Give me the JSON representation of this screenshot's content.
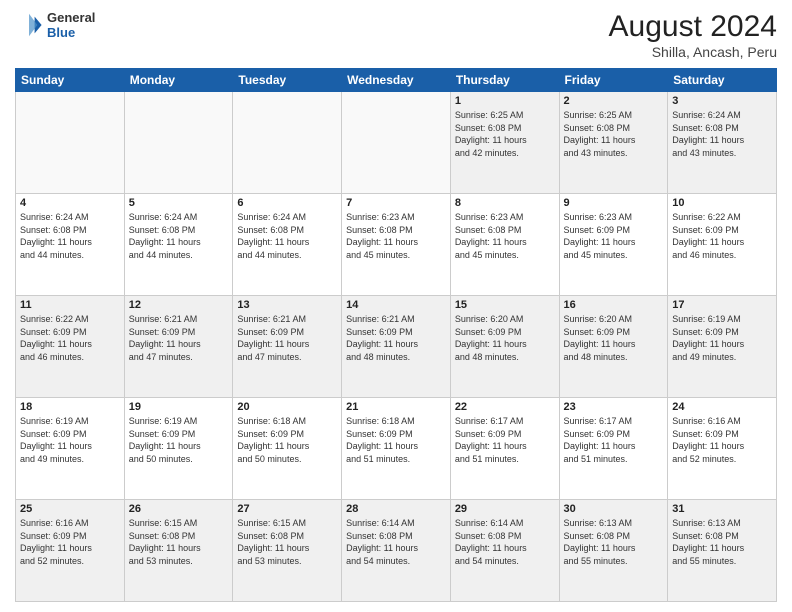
{
  "header": {
    "logo": {
      "general": "General",
      "blue": "Blue"
    },
    "title": "August 2024",
    "location": "Shilla, Ancash, Peru"
  },
  "days_of_week": [
    "Sunday",
    "Monday",
    "Tuesday",
    "Wednesday",
    "Thursday",
    "Friday",
    "Saturday"
  ],
  "weeks": [
    [
      {
        "day": "",
        "info": ""
      },
      {
        "day": "",
        "info": ""
      },
      {
        "day": "",
        "info": ""
      },
      {
        "day": "",
        "info": ""
      },
      {
        "day": "1",
        "info": "Sunrise: 6:25 AM\nSunset: 6:08 PM\nDaylight: 11 hours\nand 42 minutes."
      },
      {
        "day": "2",
        "info": "Sunrise: 6:25 AM\nSunset: 6:08 PM\nDaylight: 11 hours\nand 43 minutes."
      },
      {
        "day": "3",
        "info": "Sunrise: 6:24 AM\nSunset: 6:08 PM\nDaylight: 11 hours\nand 43 minutes."
      }
    ],
    [
      {
        "day": "4",
        "info": "Sunrise: 6:24 AM\nSunset: 6:08 PM\nDaylight: 11 hours\nand 44 minutes."
      },
      {
        "day": "5",
        "info": "Sunrise: 6:24 AM\nSunset: 6:08 PM\nDaylight: 11 hours\nand 44 minutes."
      },
      {
        "day": "6",
        "info": "Sunrise: 6:24 AM\nSunset: 6:08 PM\nDaylight: 11 hours\nand 44 minutes."
      },
      {
        "day": "7",
        "info": "Sunrise: 6:23 AM\nSunset: 6:08 PM\nDaylight: 11 hours\nand 45 minutes."
      },
      {
        "day": "8",
        "info": "Sunrise: 6:23 AM\nSunset: 6:08 PM\nDaylight: 11 hours\nand 45 minutes."
      },
      {
        "day": "9",
        "info": "Sunrise: 6:23 AM\nSunset: 6:09 PM\nDaylight: 11 hours\nand 45 minutes."
      },
      {
        "day": "10",
        "info": "Sunrise: 6:22 AM\nSunset: 6:09 PM\nDaylight: 11 hours\nand 46 minutes."
      }
    ],
    [
      {
        "day": "11",
        "info": "Sunrise: 6:22 AM\nSunset: 6:09 PM\nDaylight: 11 hours\nand 46 minutes."
      },
      {
        "day": "12",
        "info": "Sunrise: 6:21 AM\nSunset: 6:09 PM\nDaylight: 11 hours\nand 47 minutes."
      },
      {
        "day": "13",
        "info": "Sunrise: 6:21 AM\nSunset: 6:09 PM\nDaylight: 11 hours\nand 47 minutes."
      },
      {
        "day": "14",
        "info": "Sunrise: 6:21 AM\nSunset: 6:09 PM\nDaylight: 11 hours\nand 48 minutes."
      },
      {
        "day": "15",
        "info": "Sunrise: 6:20 AM\nSunset: 6:09 PM\nDaylight: 11 hours\nand 48 minutes."
      },
      {
        "day": "16",
        "info": "Sunrise: 6:20 AM\nSunset: 6:09 PM\nDaylight: 11 hours\nand 48 minutes."
      },
      {
        "day": "17",
        "info": "Sunrise: 6:19 AM\nSunset: 6:09 PM\nDaylight: 11 hours\nand 49 minutes."
      }
    ],
    [
      {
        "day": "18",
        "info": "Sunrise: 6:19 AM\nSunset: 6:09 PM\nDaylight: 11 hours\nand 49 minutes."
      },
      {
        "day": "19",
        "info": "Sunrise: 6:19 AM\nSunset: 6:09 PM\nDaylight: 11 hours\nand 50 minutes."
      },
      {
        "day": "20",
        "info": "Sunrise: 6:18 AM\nSunset: 6:09 PM\nDaylight: 11 hours\nand 50 minutes."
      },
      {
        "day": "21",
        "info": "Sunrise: 6:18 AM\nSunset: 6:09 PM\nDaylight: 11 hours\nand 51 minutes."
      },
      {
        "day": "22",
        "info": "Sunrise: 6:17 AM\nSunset: 6:09 PM\nDaylight: 11 hours\nand 51 minutes."
      },
      {
        "day": "23",
        "info": "Sunrise: 6:17 AM\nSunset: 6:09 PM\nDaylight: 11 hours\nand 51 minutes."
      },
      {
        "day": "24",
        "info": "Sunrise: 6:16 AM\nSunset: 6:09 PM\nDaylight: 11 hours\nand 52 minutes."
      }
    ],
    [
      {
        "day": "25",
        "info": "Sunrise: 6:16 AM\nSunset: 6:09 PM\nDaylight: 11 hours\nand 52 minutes."
      },
      {
        "day": "26",
        "info": "Sunrise: 6:15 AM\nSunset: 6:08 PM\nDaylight: 11 hours\nand 53 minutes."
      },
      {
        "day": "27",
        "info": "Sunrise: 6:15 AM\nSunset: 6:08 PM\nDaylight: 11 hours\nand 53 minutes."
      },
      {
        "day": "28",
        "info": "Sunrise: 6:14 AM\nSunset: 6:08 PM\nDaylight: 11 hours\nand 54 minutes."
      },
      {
        "day": "29",
        "info": "Sunrise: 6:14 AM\nSunset: 6:08 PM\nDaylight: 11 hours\nand 54 minutes."
      },
      {
        "day": "30",
        "info": "Sunrise: 6:13 AM\nSunset: 6:08 PM\nDaylight: 11 hours\nand 55 minutes."
      },
      {
        "day": "31",
        "info": "Sunrise: 6:13 AM\nSunset: 6:08 PM\nDaylight: 11 hours\nand 55 minutes."
      }
    ]
  ]
}
